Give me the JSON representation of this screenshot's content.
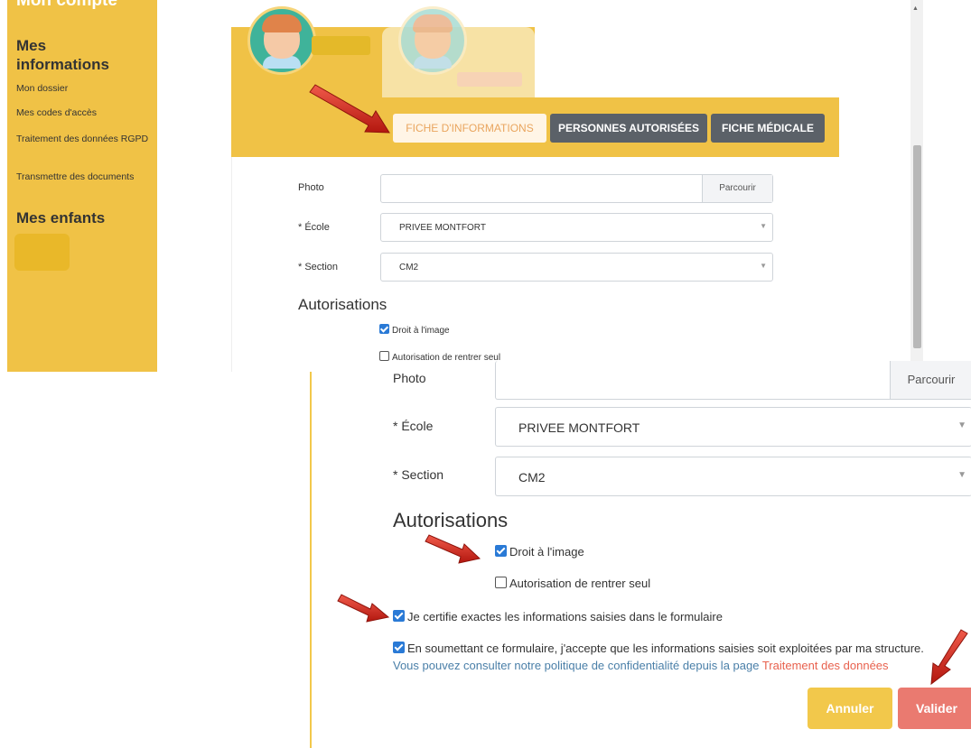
{
  "sidebar": {
    "title": "Mon compte",
    "section_info": "Mes\ninformations",
    "links": [
      "Mon dossier",
      "Mes codes d'accès",
      "Traitement des données RGPD",
      "Transmettre des documents"
    ],
    "section_children": "Mes enfants"
  },
  "tabs": {
    "fiche": "FICHE D'INFORMATIONS",
    "personnes": "PERSONNES AUTORISÉES",
    "medicale": "FICHE MÉDICALE"
  },
  "form": {
    "photo_label": "Photo",
    "browse_label": "Parcourir",
    "ecole_label": "* École",
    "ecole_value": "PRIVEE MONTFORT",
    "section_label": "* Section",
    "section_value": "CM2",
    "autorisations_heading": "Autorisations",
    "droit_image": "Droit à l'image",
    "rentrer_seul": "Autorisation de rentrer seul",
    "certifie": "Je certifie exactes les informations saisies dans le formulaire",
    "accepte": "En soumettant ce formulaire, j'accepte que les informations saisies soit exploitées par ma structure.",
    "politique_prefix": "Vous pouvez consulter notre politique de confidentialité depuis la page ",
    "politique_link": "Traitement des données",
    "cancel": "Annuler",
    "submit": "Valider"
  },
  "checkboxes": {
    "droit_image": true,
    "rentrer_seul": false,
    "certifie": true,
    "accepte": true
  },
  "colors": {
    "accent_yellow": "#f0c246",
    "tab_dark": "#5b6168",
    "checkbox_blue": "#2a7ad6",
    "submit_red": "#ea7a70",
    "link_red": "#e8614e",
    "note_blue": "#4a7fa8",
    "arrow_red": "#d42a1e"
  }
}
